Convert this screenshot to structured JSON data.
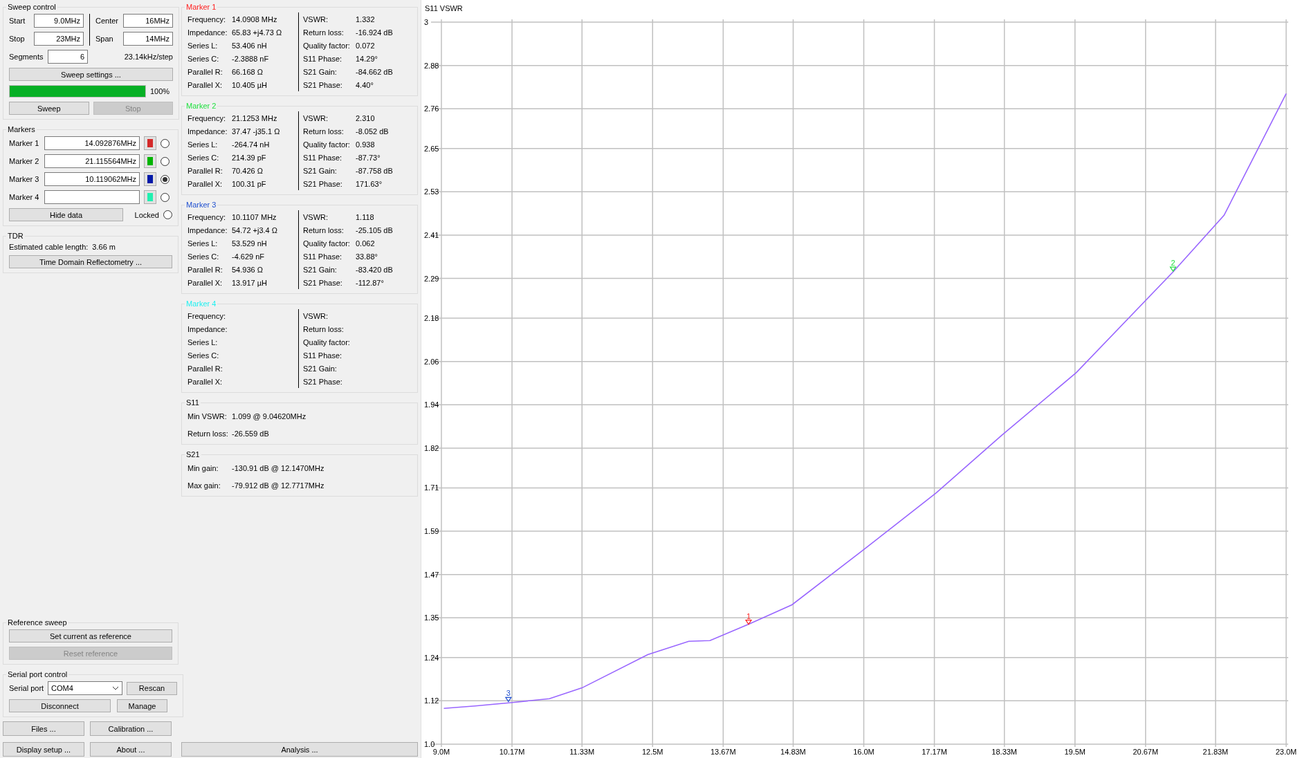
{
  "sweep_control": {
    "title": "Sweep control",
    "start_stop": [
      {
        "label": "Start",
        "value": "9.0MHz"
      },
      {
        "label": "Stop",
        "value": "23MHz"
      }
    ],
    "center_span": [
      {
        "label": "Center",
        "value": "16MHz"
      },
      {
        "label": "Span",
        "value": "14MHz"
      }
    ],
    "segments": {
      "label": "Segments",
      "value": "6"
    },
    "step": "23.14kHz/step",
    "settings_button": "Sweep settings ...",
    "progress": {
      "level": 1,
      "text": "100%"
    },
    "buttons": [
      {
        "label": "Sweep",
        "disabled": false
      },
      {
        "label": "Stop",
        "disabled": true
      }
    ]
  },
  "markers": {
    "title": "Markers",
    "items": [
      {
        "label": "Marker 1",
        "value": "14.092876MHz",
        "color": "#d42a2a",
        "selected": false
      },
      {
        "label": "Marker 2",
        "value": "21.115564MHz",
        "color": "#00b400",
        "selected": false
      },
      {
        "label": "Marker 3",
        "value": "10.119062MHz",
        "color": "#0018a8",
        "selected": true
      },
      {
        "label": "Marker 4",
        "color": "#20f0b0",
        "selected": false
      }
    ],
    "hide_button": "Hide data",
    "locked": {
      "label": "Locked",
      "checked": false
    }
  },
  "tdr": {
    "title": "TDR",
    "label": "Estimated cable length:",
    "value": "3.66 m",
    "button": "Time Domain Reflectometry ..."
  },
  "reference_sweep": {
    "title": "Reference sweep",
    "buttons": [
      {
        "label": "Set current as reference",
        "disabled": false
      },
      {
        "label": "Reset reference",
        "disabled": true
      }
    ]
  },
  "serial_port": {
    "title": "Serial port control",
    "label": "Serial port",
    "port": "COM4",
    "rescan": "Rescan",
    "disconnect": "Disconnect",
    "manage": "Manage"
  },
  "bottom_buttons": [
    {
      "label": "Files ..."
    },
    {
      "label": "Calibration ..."
    },
    {
      "label": "Display setup ..."
    },
    {
      "label": "About ..."
    }
  ],
  "marker_data": [
    {
      "title": "Marker 1",
      "color": "#ff2020",
      "left": [
        {
          "label": "Frequency:",
          "value": "14.0908 MHz"
        },
        {
          "label": "Impedance:",
          "value": "65.83 +j4.73 Ω"
        },
        {
          "label": "Series L:",
          "value": "53.406 nH"
        },
        {
          "label": "Series C:",
          "value": "-2.3888 nF"
        },
        {
          "label": "Parallel R:",
          "value": "66.168 Ω"
        },
        {
          "label": "Parallel X:",
          "value": "10.405 µH"
        }
      ],
      "right": [
        {
          "label": "VSWR:",
          "value": "1.332"
        },
        {
          "label": "Return loss:",
          "value": "-16.924 dB"
        },
        {
          "label": "Quality factor:",
          "value": "0.072"
        },
        {
          "label": "S11 Phase:",
          "value": "14.29°"
        },
        {
          "label": "S21 Gain:",
          "value": "-84.662 dB"
        },
        {
          "label": "S21 Phase:",
          "value": "4.40°"
        }
      ]
    },
    {
      "title": "Marker 2",
      "color": "#20e040",
      "left": [
        {
          "label": "Frequency:",
          "value": "21.1253 MHz"
        },
        {
          "label": "Impedance:",
          "value": "37.47 -j35.1 Ω"
        },
        {
          "label": "Series L:",
          "value": "-264.74 nH"
        },
        {
          "label": "Series C:",
          "value": "214.39 pF"
        },
        {
          "label": "Parallel R:",
          "value": "70.426 Ω"
        },
        {
          "label": "Parallel X:",
          "value": "100.31 pF"
        }
      ],
      "right": [
        {
          "label": "VSWR:",
          "value": "2.310"
        },
        {
          "label": "Return loss:",
          "value": "-8.052 dB"
        },
        {
          "label": "Quality factor:",
          "value": "0.938"
        },
        {
          "label": "S11 Phase:",
          "value": "-87.73°"
        },
        {
          "label": "S21 Gain:",
          "value": "-87.758 dB"
        },
        {
          "label": "S21 Phase:",
          "value": "171.63°"
        }
      ]
    },
    {
      "title": "Marker 3",
      "color": "#2050d0",
      "left": [
        {
          "label": "Frequency:",
          "value": "10.1107 MHz"
        },
        {
          "label": "Impedance:",
          "value": "54.72 +j3.4 Ω"
        },
        {
          "label": "Series L:",
          "value": "53.529 nH"
        },
        {
          "label": "Series C:",
          "value": "-4.629 nF"
        },
        {
          "label": "Parallel R:",
          "value": "54.936 Ω"
        },
        {
          "label": "Parallel X:",
          "value": "13.917 µH"
        }
      ],
      "right": [
        {
          "label": "VSWR:",
          "value": "1.118"
        },
        {
          "label": "Return loss:",
          "value": "-25.105 dB"
        },
        {
          "label": "Quality factor:",
          "value": "0.062"
        },
        {
          "label": "S11 Phase:",
          "value": "33.88°"
        },
        {
          "label": "S21 Gain:",
          "value": "-83.420 dB"
        },
        {
          "label": "S21 Phase:",
          "value": "-112.87°"
        }
      ]
    },
    {
      "title": "Marker 4",
      "color": "#20f0f0",
      "left": [
        {
          "label": "Frequency:"
        },
        {
          "label": "Impedance:"
        },
        {
          "label": "Series L:"
        },
        {
          "label": "Series C:"
        },
        {
          "label": "Parallel R:"
        },
        {
          "label": "Parallel X:"
        }
      ],
      "right": [
        {
          "label": "VSWR:"
        },
        {
          "label": "Return loss:"
        },
        {
          "label": "Quality factor:"
        },
        {
          "label": "S11 Phase:"
        },
        {
          "label": "S21 Gain:"
        },
        {
          "label": "S21 Phase:"
        }
      ]
    }
  ],
  "s11": {
    "title": "S11",
    "rows": [
      {
        "label": "Min VSWR:",
        "value": "1.099 @ 9.04620MHz"
      },
      {
        "label": "Return loss:",
        "value": "-26.559 dB"
      }
    ]
  },
  "s21": {
    "title": "S21",
    "rows": [
      {
        "label": "Min gain:",
        "value": "-130.91 dB @ 12.1470MHz"
      },
      {
        "label": "Max gain:",
        "value": "-79.912 dB @ 12.7717MHz"
      }
    ]
  },
  "analysis_button": "Analysis ...",
  "chart": {
    "chart_data": {
      "type": "line",
      "title": "S11 VSWR",
      "xlim": [
        9,
        23
      ],
      "ylim": [
        1,
        3
      ],
      "xticks": [
        {
          "value": 9,
          "label": "9.0M"
        },
        {
          "value": 10.17,
          "label": "10.17M"
        },
        {
          "value": 11.33,
          "label": "11.33M"
        },
        {
          "value": 12.5,
          "label": "12.5M"
        },
        {
          "value": 13.67,
          "label": "13.67M"
        },
        {
          "value": 14.83,
          "label": "14.83M"
        },
        {
          "value": 16,
          "label": "16.0M"
        },
        {
          "value": 17.17,
          "label": "17.17M"
        },
        {
          "value": 18.33,
          "label": "18.33M"
        },
        {
          "value": 19.5,
          "label": "19.5M"
        },
        {
          "value": 20.67,
          "label": "20.67M"
        },
        {
          "value": 21.83,
          "label": "21.83M"
        },
        {
          "value": 23,
          "label": "23.0M"
        }
      ],
      "yticks": [
        {
          "value": 1,
          "label": "1.0"
        },
        {
          "value": 1.12,
          "label": "1.12"
        },
        {
          "value": 1.24,
          "label": "1.24"
        },
        {
          "value": 1.35,
          "label": "1.35"
        },
        {
          "value": 1.47,
          "label": "1.47"
        },
        {
          "value": 1.59,
          "label": "1.59"
        },
        {
          "value": 1.71,
          "label": "1.71"
        },
        {
          "value": 1.82,
          "label": "1.82"
        },
        {
          "value": 1.94,
          "label": "1.94"
        },
        {
          "value": 2.06,
          "label": "2.06"
        },
        {
          "value": 2.18,
          "label": "2.18"
        },
        {
          "value": 2.29,
          "label": "2.29"
        },
        {
          "value": 2.41,
          "label": "2.41"
        },
        {
          "value": 2.53,
          "label": "2.53"
        },
        {
          "value": 2.65,
          "label": "2.65"
        },
        {
          "value": 2.76,
          "label": "2.76"
        },
        {
          "value": 2.88,
          "label": "2.88"
        },
        {
          "value": 3,
          "label": "3"
        }
      ],
      "x": [
        9.04,
        9.56,
        10.15,
        10.79,
        11.33,
        12.42,
        13.1,
        13.45,
        14.1,
        14.81,
        15.97,
        17.2,
        18.29,
        19.52,
        21.13,
        21.97,
        23.0
      ],
      "series": [
        {
          "color": "#9966ff",
          "values": [
            1.099,
            1.106,
            1.115,
            1.126,
            1.156,
            1.248,
            1.285,
            1.287,
            1.333,
            1.386,
            1.535,
            1.696,
            1.856,
            2.029,
            2.309,
            2.465,
            2.802
          ]
        }
      ],
      "grid": true,
      "annotations": [
        {
          "x": 14.0908,
          "y": 1.332,
          "text": "1"
        },
        {
          "x": 21.1253,
          "y": 2.31,
          "text": "2"
        },
        {
          "x": 10.1107,
          "y": 1.118,
          "text": "3"
        }
      ]
    }
  }
}
